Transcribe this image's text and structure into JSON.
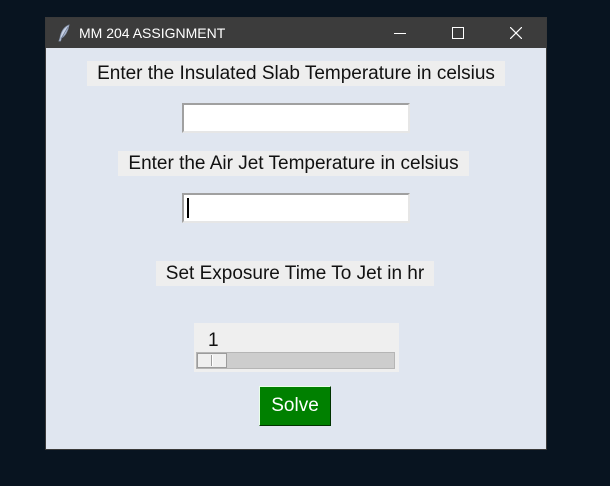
{
  "window": {
    "title": "MM 204 ASSIGNMENT"
  },
  "form": {
    "slab_label": "Enter the Insulated Slab Temperature in celsius",
    "slab_value": "",
    "air_label": "Enter the Air Jet Temperature in celsius",
    "air_value": "",
    "exposure_label": "Set Exposure Time To Jet in hr",
    "exposure_value": "1",
    "exposure_fraction": 0,
    "solve_label": "Solve"
  },
  "colors": {
    "desktop": "#081420",
    "window_bg": "#e0e6f0",
    "titlebar": "#3c3c3c",
    "solve_button": "#008000"
  },
  "icons": {
    "app": "feather-icon",
    "minimize": "minimize-icon",
    "maximize": "maximize-icon",
    "close": "close-icon"
  }
}
